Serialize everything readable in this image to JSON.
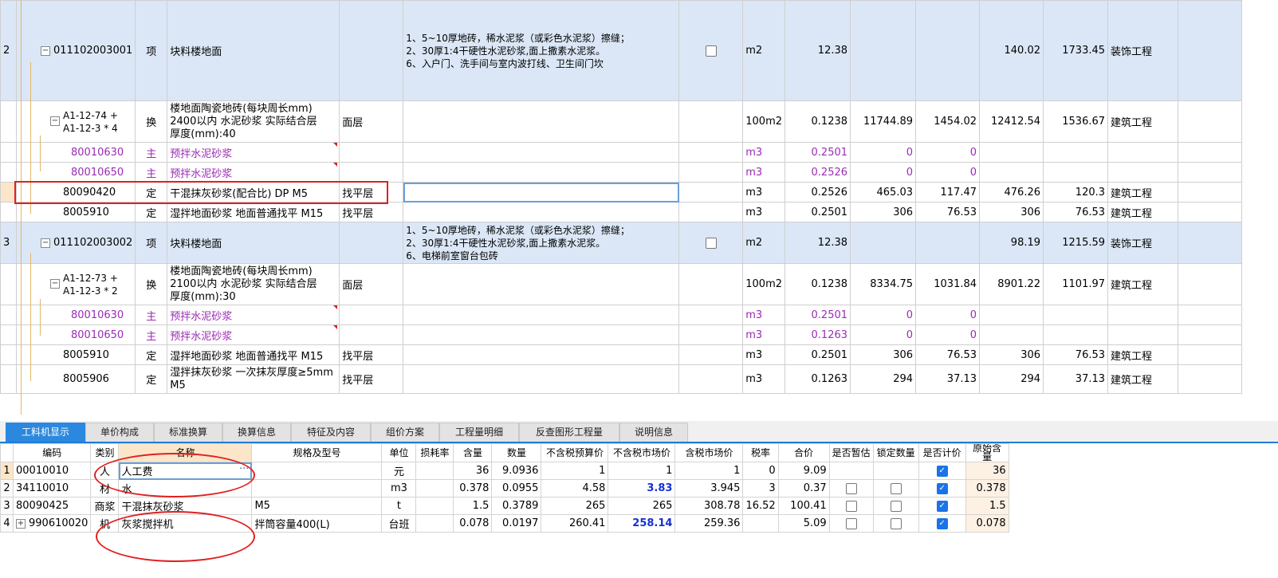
{
  "upper_rows": [
    {
      "no": "2",
      "code": "011102003001",
      "type": "项",
      "name": "块料楼地面",
      "spec": "",
      "feature_lines": [
        "1、5~10厚地砖，稀水泥浆（或彩色水泥浆）擦缝；",
        "2、30厚1:4干硬性水泥砂浆,面上撒素水泥浆。",
        "6、入户门、洗手间与室内波打线、卫生间门坎"
      ],
      "unit": "m2",
      "qty": "12.38",
      "c1": "",
      "c2": "",
      "c3": "140.02",
      "c4": "1733.45",
      "prof": "装饰工程"
    },
    {
      "no": "",
      "code_lines": [
        "A1-12-74 +",
        "A1-12-3 * 4"
      ],
      "type": "换",
      "name_lines": [
        "楼地面陶瓷地砖(每块周长mm)",
        "2400以内 水泥砂浆  实际结合层",
        "厚度(mm):40"
      ],
      "spec": "面层",
      "unit": "100m2",
      "qty": "0.1238",
      "c1": "11744.89",
      "c2": "1454.02",
      "c3": "12412.54",
      "c4": "1536.67",
      "prof": "建筑工程"
    },
    {
      "code": "80010630",
      "type": "主",
      "name": "预拌水泥砂浆",
      "unit": "m3",
      "qty": "0.2501",
      "c1": "0",
      "c2": "0"
    },
    {
      "code": "80010650",
      "type": "主",
      "name": "预拌水泥砂浆",
      "unit": "m3",
      "qty": "0.2526",
      "c1": "0",
      "c2": "0"
    },
    {
      "code": "80090420",
      "type": "定",
      "name": "干混抹灰砂浆(配合比) DP M5",
      "spec": "找平层",
      "unit": "m3",
      "qty": "0.2526",
      "c1": "465.03",
      "c2": "117.47",
      "c3": "476.26",
      "c4": "120.3",
      "prof": "建筑工程"
    },
    {
      "code": "8005910",
      "type": "定",
      "name": "湿拌地面砂浆 地面普通找平 M15",
      "spec": "找平层",
      "unit": "m3",
      "qty": "0.2501",
      "c1": "306",
      "c2": "76.53",
      "c3": "306",
      "c4": "76.53",
      "prof": "建筑工程"
    },
    {
      "no": "3",
      "code": "011102003002",
      "type": "项",
      "name": "块料楼地面",
      "feature_lines": [
        "1、5~10厚地砖，稀水泥浆（或彩色水泥浆）擦缝；",
        "2、30厚1:4干硬性水泥砂浆,面上撒素水泥浆。",
        "6、电梯前室窗台包砖"
      ],
      "unit": "m2",
      "qty": "12.38",
      "c3": "98.19",
      "c4": "1215.59",
      "prof": "装饰工程"
    },
    {
      "code_lines": [
        "A1-12-73 +",
        "A1-12-3 * 2"
      ],
      "type": "换",
      "name_lines": [
        "楼地面陶瓷地砖(每块周长mm)",
        "2100以内 水泥砂浆  实际结合层",
        "厚度(mm):30"
      ],
      "spec": "面层",
      "unit": "100m2",
      "qty": "0.1238",
      "c1": "8334.75",
      "c2": "1031.84",
      "c3": "8901.22",
      "c4": "1101.97",
      "prof": "建筑工程"
    },
    {
      "code": "80010630",
      "type": "主",
      "name": "预拌水泥砂浆",
      "unit": "m3",
      "qty": "0.2501",
      "c1": "0",
      "c2": "0"
    },
    {
      "code": "80010650",
      "type": "主",
      "name": "预拌水泥砂浆",
      "unit": "m3",
      "qty": "0.1263",
      "c1": "0",
      "c2": "0"
    },
    {
      "code": "8005910",
      "type": "定",
      "name": "湿拌地面砂浆 地面普通找平 M15",
      "spec": "找平层",
      "unit": "m3",
      "qty": "0.2501",
      "c1": "306",
      "c2": "76.53",
      "c3": "306",
      "c4": "76.53",
      "prof": "建筑工程"
    },
    {
      "code": "8005906",
      "type": "定",
      "name_lines": [
        "湿拌抹灰砂浆 一次抹灰厚度≥5mm",
        "M5"
      ],
      "spec": "找平层",
      "unit": "m3",
      "qty": "0.1263",
      "c1": "294",
      "c2": "37.13",
      "c3": "294",
      "c4": "37.13",
      "prof": "建筑工程"
    }
  ],
  "tabs": [
    "工料机显示",
    "单价构成",
    "标准换算",
    "换算信息",
    "特征及内容",
    "组价方案",
    "工程量明细",
    "反查图形工程量",
    "说明信息"
  ],
  "lower_headers": [
    "编码",
    "类别",
    "名称",
    "规格及型号",
    "单位",
    "损耗率",
    "含量",
    "数量",
    "不含税预算价",
    "不含税市场价",
    "含税市场价",
    "税率",
    "合价",
    "是否暂估",
    "锁定数量",
    "是否计价",
    "原始含量"
  ],
  "lower_rows": [
    {
      "n": "1",
      "code": "00010010",
      "cat": "人",
      "name": "人工费",
      "more": "···",
      "spec": "",
      "unit": "元",
      "loss": "",
      "content": "36",
      "qty": "9.0936",
      "p1": "1",
      "p2": "1",
      "p3": "1",
      "tax": "0",
      "total": "9.09",
      "orig": "36"
    },
    {
      "n": "2",
      "code": "34110010",
      "cat": "材",
      "name": "水",
      "spec": "",
      "unit": "m3",
      "loss": "",
      "content": "0.378",
      "qty": "0.0955",
      "p1": "4.58",
      "p2": "3.83",
      "p3": "3.945",
      "tax": "3",
      "total": "0.37",
      "orig": "0.378"
    },
    {
      "n": "3",
      "code": "80090425",
      "cat": "商浆",
      "name": "干混抹灰砂浆",
      "spec": "M5",
      "unit": "t",
      "loss": "",
      "content": "1.5",
      "qty": "0.3789",
      "p1": "265",
      "p2": "265",
      "p3": "308.78",
      "tax": "16.52",
      "total": "100.41",
      "orig": "1.5"
    },
    {
      "n": "4",
      "code": "990610020",
      "cat": "机",
      "name": "灰浆搅拌机",
      "spec": "拌筒容量400(L)",
      "unit": "台班",
      "loss": "",
      "content": "0.078",
      "qty": "0.0197",
      "p1": "260.41",
      "p2": "258.14",
      "p3": "259.36",
      "tax": "",
      "total": "5.09",
      "orig": "0.078"
    }
  ],
  "colors": {
    "tab_active": "#2b88de",
    "selected_row": "#dbe7f6",
    "sub_text": "#9b2bb5",
    "highlight_price": "#1531d6",
    "annotation": "#e02020"
  }
}
